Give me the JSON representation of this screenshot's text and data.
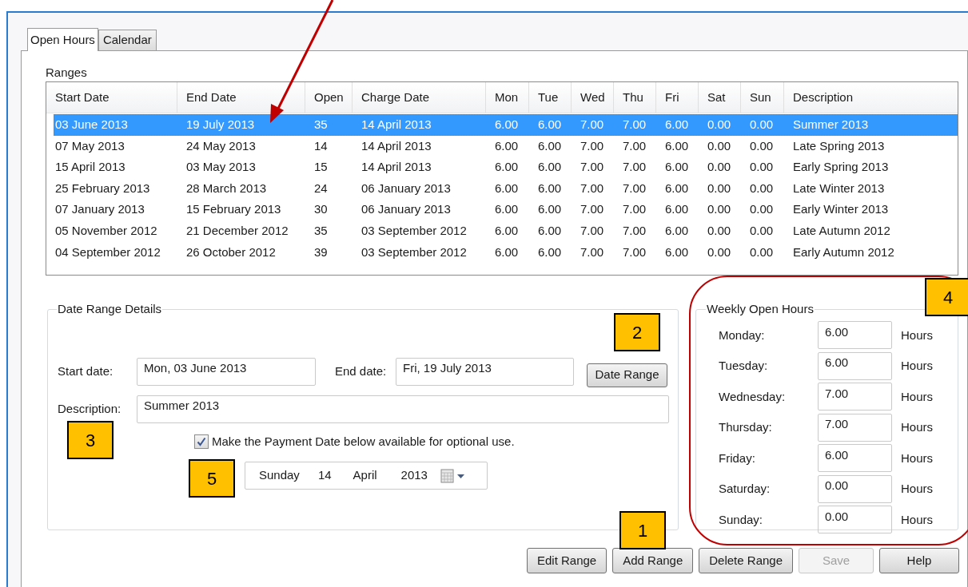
{
  "tabs": [
    {
      "label": "Open Hours",
      "selected": true
    },
    {
      "label": "Calendar",
      "selected": false
    }
  ],
  "ranges": {
    "title": "Ranges",
    "columns": [
      "Start Date",
      "End Date",
      "Open",
      "Charge Date",
      "Mon",
      "Tue",
      "Wed",
      "Thu",
      "Fri",
      "Sat",
      "Sun",
      "Description"
    ],
    "rows": [
      {
        "selected": true,
        "cells": [
          "03 June 2013",
          "19 July 2013",
          "35",
          "14 April 2013",
          "6.00",
          "6.00",
          "7.00",
          "7.00",
          "6.00",
          "0.00",
          "0.00",
          "Summer 2013"
        ]
      },
      {
        "selected": false,
        "cells": [
          "07 May 2013",
          "24 May 2013",
          "14",
          "14 April 2013",
          "6.00",
          "6.00",
          "7.00",
          "7.00",
          "6.00",
          "0.00",
          "0.00",
          "Late Spring 2013"
        ]
      },
      {
        "selected": false,
        "cells": [
          "15 April 2013",
          "03 May 2013",
          "15",
          "14 April 2013",
          "6.00",
          "6.00",
          "7.00",
          "7.00",
          "6.00",
          "0.00",
          "0.00",
          "Early Spring 2013"
        ]
      },
      {
        "selected": false,
        "cells": [
          "25 February 2013",
          "28 March 2013",
          "24",
          "06 January 2013",
          "6.00",
          "6.00",
          "7.00",
          "7.00",
          "6.00",
          "0.00",
          "0.00",
          "Late Winter 2013"
        ]
      },
      {
        "selected": false,
        "cells": [
          "07 January 2013",
          "15 February 2013",
          "30",
          "06 January 2013",
          "6.00",
          "6.00",
          "7.00",
          "7.00",
          "6.00",
          "0.00",
          "0.00",
          "Early Winter 2013"
        ]
      },
      {
        "selected": false,
        "cells": [
          "05 November 2012",
          "21 December 2012",
          "35",
          "03 September 2012",
          "6.00",
          "6.00",
          "7.00",
          "7.00",
          "6.00",
          "0.00",
          "0.00",
          "Late Autumn 2012"
        ]
      },
      {
        "selected": false,
        "cells": [
          "04 September 2012",
          "26 October 2012",
          "39",
          "03 September 2012",
          "6.00",
          "6.00",
          "7.00",
          "7.00",
          "6.00",
          "0.00",
          "0.00",
          "Early Autumn 2012"
        ]
      }
    ]
  },
  "date_range_details": {
    "title": "Date Range Details",
    "start_date": {
      "label": "Start date:",
      "value": "Mon, 03 June 2013"
    },
    "end_date": {
      "label": "End date:",
      "value": "Fri, 19 July 2013"
    },
    "date_range_button": "Date Range",
    "description": {
      "label": "Description:",
      "value": "Summer 2013"
    },
    "payment_option": {
      "label": "Make the Payment Date below available for optional use.",
      "checked": true
    },
    "payment_date": {
      "day_name": "Sunday",
      "day": "14",
      "month": "April",
      "year": "2013"
    }
  },
  "weekly_open_hours": {
    "title": "Weekly Open Hours",
    "days": [
      {
        "label": "Monday:",
        "value": "6.00",
        "unit": "Hours"
      },
      {
        "label": "Tuesday:",
        "value": "6.00",
        "unit": "Hours"
      },
      {
        "label": "Wednesday:",
        "value": "7.00",
        "unit": "Hours"
      },
      {
        "label": "Thursday:",
        "value": "7.00",
        "unit": "Hours"
      },
      {
        "label": "Friday:",
        "value": "6.00",
        "unit": "Hours"
      },
      {
        "label": "Saturday:",
        "value": "0.00",
        "unit": "Hours"
      },
      {
        "label": "Sunday:",
        "value": "0.00",
        "unit": "Hours"
      }
    ]
  },
  "buttons": [
    {
      "label": "Edit Range",
      "disabled": false
    },
    {
      "label": "Add Range",
      "disabled": false
    },
    {
      "label": "Delete Range",
      "disabled": false
    },
    {
      "label": "Save",
      "disabled": true
    },
    {
      "label": "Help",
      "disabled": false
    }
  ],
  "callouts": [
    "1",
    "2",
    "3",
    "4",
    "5"
  ]
}
